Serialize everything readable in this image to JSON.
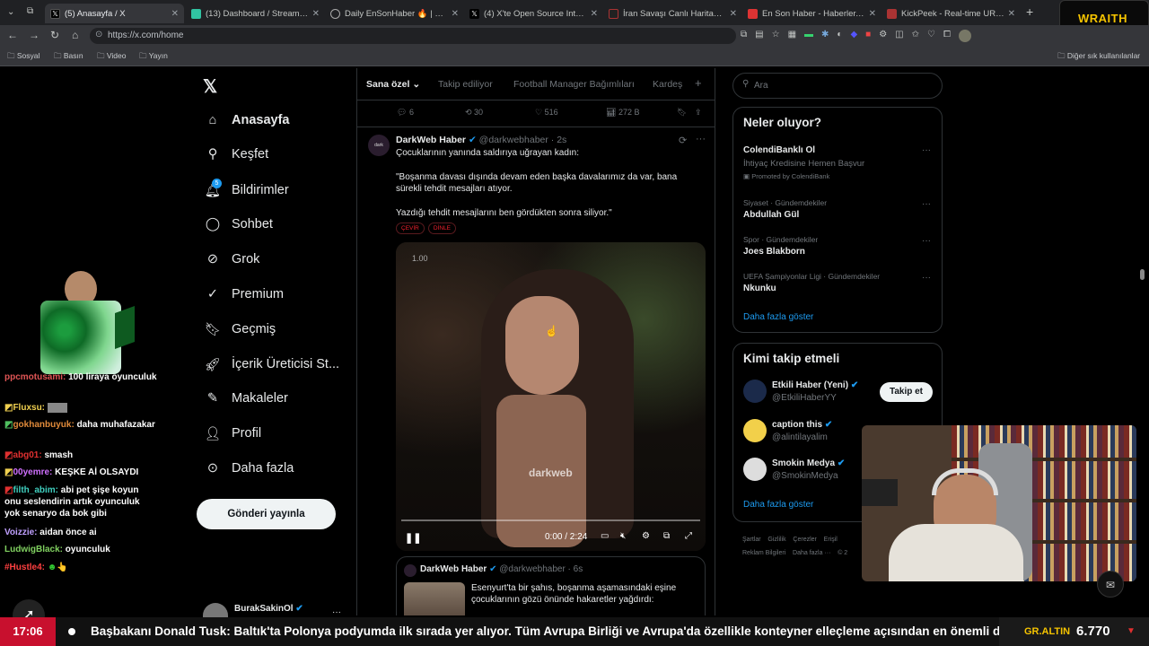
{
  "browser": {
    "tabs": [
      {
        "title": "(5) Anasayfa / X",
        "active": true
      },
      {
        "title": "(13) Dashboard / Streamlabs"
      },
      {
        "title": "Daily EnSonHaber 🔥 | Günün En"
      },
      {
        "title": "(4) X'te Open Source Intel: \"A Sy"
      },
      {
        "title": "İran Savaşı Canlı Haritası - SakinO"
      },
      {
        "title": "En Son Haber - Haberler, Son Da"
      },
      {
        "title": "KickPeek - Real-time URL Crawle"
      }
    ],
    "url": "https://x.com/home",
    "bookmarks": [
      "Sosyal",
      "Basın",
      "Video",
      "Yayın"
    ],
    "other_bookmarks": "Diğer sık kullanılanlar",
    "overlay_brand": "WRAITH"
  },
  "nav": {
    "items": [
      "Anasayfa",
      "Keşfet",
      "Bildirimler",
      "Sohbet",
      "Grok",
      "Premium",
      "Geçmiş",
      "İçerik Üreticisi St...",
      "Makaleler",
      "Profil",
      "Daha fazla"
    ],
    "notif_count": "5",
    "post_button": "Gönderi yayınla",
    "account": "BurakSakinOl"
  },
  "feed": {
    "tabs": [
      "Sana özel",
      "Takip ediliyor",
      "Football Manager Bağımlıları",
      "Kardeş"
    ],
    "prev_stats": [
      "6",
      "30",
      "516",
      "272 B"
    ],
    "post": {
      "author": "DarkWeb Haber",
      "handle": "@darkwebhaber · 2s",
      "line1": "Çocuklarının yanında saldırıya uğrayan kadın:",
      "line2": "\"Boşanma davası dışında devam eden başka davalarımız da var, bana sürekli tehdit mesajları atıyor.",
      "line3": "Yazdığı tehdit mesajlarını ben gördükten sonra siliyor.\"",
      "tags": [
        "ÇEVİR",
        "DİNLE"
      ],
      "video_speed": "1.00",
      "video_time": "0:00 / 2:24",
      "watermark": "darkweb"
    },
    "quote": {
      "author": "DarkWeb Haber",
      "handle": "@darkwebhaber · 6s",
      "text1": "Esenyurt'ta bir şahıs, boşanma aşamasındaki eşine",
      "text2": "çocuklarının gözü önünde hakaretler yağdırdı:"
    }
  },
  "right": {
    "search_placeholder": "Ara",
    "trends_title": "Neler oluyor?",
    "trends": [
      {
        "meta": "",
        "name": "ColendiBanklı Ol",
        "sub": "İhtiyaç Kredisine Hemen Başvur",
        "promo": "Promoted by ColendiBank"
      },
      {
        "meta": "Siyaset · Gündemdekiler",
        "name": "Abdullah Gül"
      },
      {
        "meta": "Spor · Gündemdekiler",
        "name": "Joes Blakborn"
      },
      {
        "meta": "UEFA Şampiyonlar Ligi · Gündemdekiler",
        "name": "Nkunku"
      }
    ],
    "show_more": "Daha fazla göster",
    "who_title": "Kimi takip etmeli",
    "who": [
      {
        "name": "Etkili Haber (Yeni)",
        "handle": "@EtkiliHaberYY"
      },
      {
        "name": "caption this",
        "handle": "@alintilayalim"
      },
      {
        "name": "Smokin Medya",
        "handle": "@SmokinMedya"
      }
    ],
    "follow": "Takip et",
    "footer": [
      "Şartlar",
      "Gizlilik",
      "Çerezler",
      "Erişil",
      "Reklam Bilgileri",
      "Daha fazla ···",
      "© 2"
    ]
  },
  "chat": [
    {
      "user": "ppcmotusami:",
      "msg": "100 liraya oyunculuk",
      "color": "#e05555"
    },
    {
      "user": "Fluxsu:",
      "msg": "",
      "color": "#f0d050"
    },
    {
      "user": "gokhanbuyuk:",
      "msg": "daha muhafazakar",
      "color": "#e08a3a"
    },
    {
      "user": "abg01:",
      "msg": "smash",
      "color": "#e03030"
    },
    {
      "user": "00yemre:",
      "msg": "KEŞKE Aİ OLSAYDI",
      "color": "#d070ff"
    },
    {
      "user": "filth_abim:",
      "msg": "abi pet şişe koyun onu seslendirin artık oyunculuk yok senaryo da bok gibi",
      "color": "#40d0c0"
    },
    {
      "user": "Voizzie:",
      "msg": "aidan önce ai",
      "color": "#c0a0ff"
    },
    {
      "user": "LudwigBlack:",
      "msg": "oyunculuk",
      "color": "#80d060"
    },
    {
      "user": "#Hustle4:",
      "msg": "",
      "color": "#ff4040"
    }
  ],
  "ticker": {
    "time": "17:06",
    "text": "Başbakanı Donald Tusk: Baltık'ta Polonya podyumda ilk sırada yer alıyor. Tüm Avrupa Birliği ve Avrupa'da özellikle konteyner elleçleme açısından en önemli d",
    "label": "GR.ALTIN",
    "value": "6.770"
  }
}
